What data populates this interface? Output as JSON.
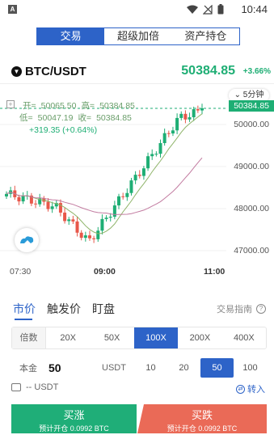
{
  "status_bar": {
    "app_badge": "A",
    "time": "10:44"
  },
  "segments": [
    {
      "label": "交易",
      "active": true
    },
    {
      "label": "超级加倍",
      "active": false
    },
    {
      "label": "资产持仓",
      "active": false
    }
  ],
  "pair": {
    "name": "BTC/USDT",
    "price": "50384.85",
    "change": "+3.66%"
  },
  "chart": {
    "open_label": "开=",
    "open": "50065.50",
    "high_label": "高=",
    "high": "50384.85",
    "low_label": "低=",
    "low": "50047.19",
    "close_label": "收=",
    "close": "50384.85",
    "change_text": "+319.35 (+0.64%)",
    "interval": "5分钟",
    "last_price_tag": "50384.85",
    "y_ticks": [
      "50000.00",
      "49000.00",
      "48000.00",
      "47000.00"
    ],
    "x_ticks": [
      "07:30",
      "09:00",
      "11:00"
    ]
  },
  "chart_data": {
    "type": "candlestick",
    "y_ticks": [
      50000,
      49000,
      48000,
      47000
    ],
    "x_ticks": [
      "07:30",
      "09:00",
      "11:00"
    ],
    "last_price": 50384.85,
    "open": 50065.5,
    "high": 50384.85,
    "low": 50047.19,
    "close": 50384.85,
    "colors": {
      "up": "#1eae74",
      "down": "#e8574a",
      "ma1": "#8fb46a",
      "ma2": "#c27ba0"
    }
  },
  "order_tabs": [
    "市价",
    "触发价",
    "盯盘"
  ],
  "guide": "交易指南",
  "leverage": {
    "label": "倍数",
    "options": [
      "20X",
      "50X",
      "100X",
      "200X",
      "400X"
    ],
    "selected": "100X"
  },
  "amount": {
    "label": "本金",
    "value": "50",
    "unit": "USDT",
    "quick": [
      "10",
      "20",
      "50",
      "100"
    ],
    "selected": "50"
  },
  "balance": {
    "text": "-- USDT",
    "transfer": "转入"
  },
  "buy": {
    "label": "买涨",
    "sub": "预计开仓 0.0992 BTC"
  },
  "sell": {
    "label": "买跌",
    "sub": "预计开仓 0.0992 BTC"
  }
}
